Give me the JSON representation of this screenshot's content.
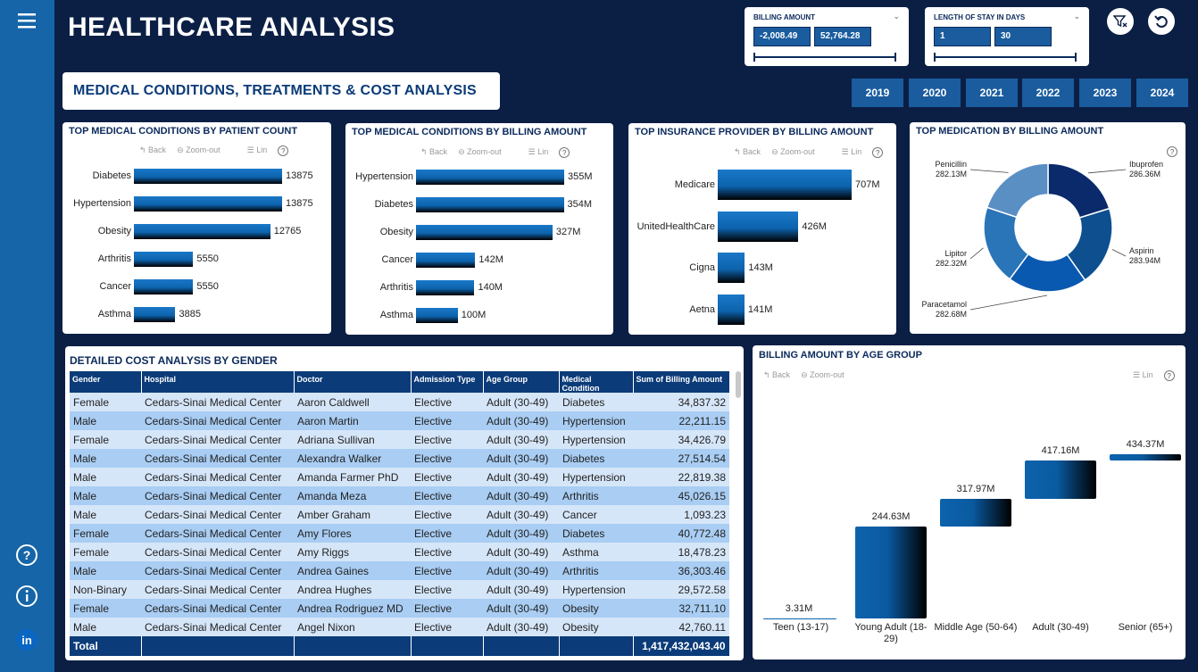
{
  "header": {
    "title": "HEALTHCARE ANALYSIS",
    "subtitle": "MEDICAL CONDITIONS, TREATMENTS & COST ANALYSIS"
  },
  "slicers": {
    "billing": {
      "label": "BILLING AMOUNT",
      "min": "-2,008.49",
      "max": "52,764.28"
    },
    "stay": {
      "label": "LENGTH OF STAY IN DAYS",
      "min": "1",
      "max": "30"
    }
  },
  "years": [
    "2019",
    "2020",
    "2021",
    "2022",
    "2023",
    "2024"
  ],
  "toolbar": {
    "back": "Back",
    "zoom": "Zoom-out",
    "lin": "Lin",
    "help": "?"
  },
  "icons": {
    "menu": "hamburger-icon",
    "help": "question-circle-icon",
    "info": "info-circle-icon",
    "linkedin": "linkedin-icon",
    "filter": "clear-filter-icon",
    "reset": "undo-icon"
  },
  "charts": {
    "patient": {
      "title": "TOP MEDICAL CONDITIONS BY PATIENT COUNT",
      "chart_data": {
        "type": "bar",
        "categories": [
          "Diabetes",
          "Hypertension",
          "Obesity",
          "Arthritis",
          "Cancer",
          "Asthma"
        ],
        "values": [
          13875,
          13875,
          12765,
          5550,
          5550,
          3885
        ],
        "labels": [
          "13875",
          "13875",
          "12765",
          "5550",
          "5550",
          "3885"
        ],
        "max": 13875
      }
    },
    "billing": {
      "title": "TOP MEDICAL CONDITIONS BY BILLING AMOUNT",
      "chart_data": {
        "type": "bar",
        "categories": [
          "Hypertension",
          "Diabetes",
          "Obesity",
          "Cancer",
          "Arthritis",
          "Asthma"
        ],
        "values": [
          355,
          354,
          327,
          142,
          140,
          100
        ],
        "labels": [
          "355M",
          "354M",
          "327M",
          "142M",
          "140M",
          "100M"
        ],
        "max": 355
      }
    },
    "insurance": {
      "title": "TOP INSURANCE PROVIDER BY BILLING AMOUNT",
      "chart_data": {
        "type": "bar",
        "categories": [
          "Medicare",
          "UnitedHealthCare",
          "Cigna",
          "Aetna"
        ],
        "values": [
          707,
          426,
          143,
          141
        ],
        "labels": [
          "707M",
          "426M",
          "143M",
          "141M"
        ],
        "max": 707
      }
    },
    "medication": {
      "title": "TOP MEDICATION BY BILLING AMOUNT",
      "chart_data": {
        "type": "pie",
        "categories": [
          "Ibuprofen",
          "Aspirin",
          "Paracetamol",
          "Lipitor",
          "Penicillin"
        ],
        "values": [
          286.36,
          283.94,
          282.68,
          282.32,
          282.13
        ],
        "labels": [
          "286.36M",
          "283.94M",
          "282.68M",
          "282.32M",
          "282.13M"
        ],
        "colors": [
          "#0b2a6b",
          "#0d4f8f",
          "#0a59b0",
          "#2a74b8",
          "#5a8fc4"
        ]
      }
    },
    "age": {
      "title": "BILLING AMOUNT BY AGE GROUP",
      "chart_data": {
        "type": "waterfall",
        "categories": [
          "Teen (13-17)",
          "Young Adult (18-29)",
          "Middle Age (50-64)",
          "Adult (30-49)",
          "Senior (65+)"
        ],
        "values": [
          3.31,
          244.63,
          317.97,
          417.16,
          434.37
        ],
        "labels": [
          "3.31M",
          "244.63M",
          "317.97M",
          "417.16M",
          "434.37M"
        ]
      }
    }
  },
  "table": {
    "title": "DETAILED COST ANALYSIS BY GENDER",
    "columns": [
      "Gender",
      "Hospital",
      "Doctor",
      "Admission Type",
      "Age Group",
      "Medical Condition",
      "Sum of Billing Amount"
    ],
    "rows": [
      [
        "Female",
        "Cedars-Sinai Medical Center",
        "Aaron Caldwell",
        "Elective",
        "Adult (30-49)",
        "Diabetes",
        "34,837.32"
      ],
      [
        "Male",
        "Cedars-Sinai Medical Center",
        "Aaron Martin",
        "Elective",
        "Adult (30-49)",
        "Hypertension",
        "22,211.15"
      ],
      [
        "Female",
        "Cedars-Sinai Medical Center",
        "Adriana Sullivan",
        "Elective",
        "Adult (30-49)",
        "Hypertension",
        "34,426.79"
      ],
      [
        "Male",
        "Cedars-Sinai Medical Center",
        "Alexandra Walker",
        "Elective",
        "Adult (30-49)",
        "Diabetes",
        "27,514.54"
      ],
      [
        "Male",
        "Cedars-Sinai Medical Center",
        "Amanda Farmer PhD",
        "Elective",
        "Adult (30-49)",
        "Hypertension",
        "22,819.38"
      ],
      [
        "Male",
        "Cedars-Sinai Medical Center",
        "Amanda Meza",
        "Elective",
        "Adult (30-49)",
        "Arthritis",
        "45,026.15"
      ],
      [
        "Male",
        "Cedars-Sinai Medical Center",
        "Amber Graham",
        "Elective",
        "Adult (30-49)",
        "Cancer",
        "1,093.23"
      ],
      [
        "Female",
        "Cedars-Sinai Medical Center",
        "Amy Flores",
        "Elective",
        "Adult (30-49)",
        "Diabetes",
        "40,772.48"
      ],
      [
        "Female",
        "Cedars-Sinai Medical Center",
        "Amy Riggs",
        "Elective",
        "Adult (30-49)",
        "Asthma",
        "18,478.23"
      ],
      [
        "Male",
        "Cedars-Sinai Medical Center",
        "Andrea Gaines",
        "Elective",
        "Adult (30-49)",
        "Arthritis",
        "36,303.46"
      ],
      [
        "Non-Binary",
        "Cedars-Sinai Medical Center",
        "Andrea Hughes",
        "Elective",
        "Adult (30-49)",
        "Hypertension",
        "29,572.58"
      ],
      [
        "Female",
        "Cedars-Sinai Medical Center",
        "Andrea Rodriguez MD",
        "Elective",
        "Adult (30-49)",
        "Obesity",
        "32,711.10"
      ],
      [
        "Male",
        "Cedars-Sinai Medical Center",
        "Angel Nixon",
        "Elective",
        "Adult (30-49)",
        "Obesity",
        "42,760.11"
      ]
    ],
    "total_label": "Total",
    "total_value": "1,417,432,043.40"
  }
}
